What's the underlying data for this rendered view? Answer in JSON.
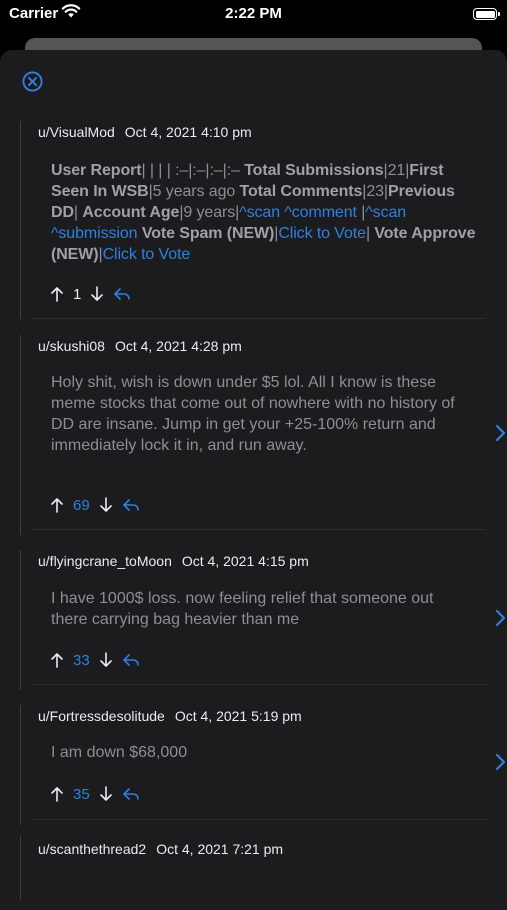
{
  "status_bar": {
    "carrier": "Carrier",
    "time": "2:22 PM"
  },
  "colors": {
    "accent": "#2f80e0",
    "background": "#1c1c1e",
    "text_muted": "#8e8e93"
  },
  "comments": [
    {
      "author": "u/VisualMod",
      "date": "Oct 4, 2021 4:10 pm",
      "report": {
        "t1": "User Report",
        "t2": "| | | | :–|:–|:–|:– ",
        "t3": "Total Submissions",
        "t4": "|21|",
        "t5": "First Seen In WSB",
        "t6": "|5 years ago ",
        "t7": "Total Comments",
        "t8": "|23|",
        "t9": "Previous DD",
        "t10": "| ",
        "t11": "Account Age",
        "t12": "|9 years|",
        "l1": "^scan ^comment",
        "t13": " |",
        "l2": "^scan ^submission",
        "t14": " ",
        "t15": "Vote Spam (NEW)",
        "t16": "|",
        "l3": "Click to Vote",
        "t17": "| ",
        "t18": "Vote Approve (NEW)",
        "t19": "|",
        "l4": "Click to Vote"
      },
      "votes": "1"
    },
    {
      "author": "u/skushi08",
      "date": "Oct 4, 2021 4:28 pm",
      "text": "Holy shit, wish is down under $5 lol. All I know is these meme stocks that come out of nowhere with no history of DD are insane. Jump in get your +25-100% return and immediately lock it in, and run away.",
      "votes": "69"
    },
    {
      "author": "u/flyingcrane_toMoon",
      "date": "Oct 4, 2021 4:15 pm",
      "text": "I have 1000$ loss. now feeling relief that someone out there carrying bag heavier than me",
      "votes": "33"
    },
    {
      "author": "u/Fortressdesolitude",
      "date": "Oct 4, 2021 5:19 pm",
      "text": "I am down $68,000",
      "votes": "35"
    },
    {
      "author": "u/scanthethread2",
      "date": "Oct 4, 2021 7:21 pm"
    }
  ],
  "icons": {
    "close": "close-circle-icon",
    "upvote": "arrow-up-icon",
    "downvote": "arrow-down-icon",
    "reply": "reply-icon",
    "open": "chevron-right-icon"
  }
}
